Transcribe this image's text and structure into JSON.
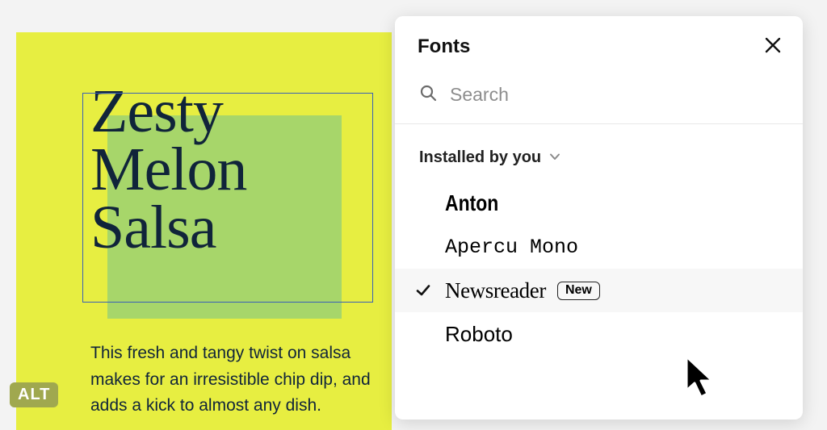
{
  "canvas": {
    "headline": "Zesty\nMelon\nSalsa",
    "body": "This fresh and tangy twist on salsa makes for an irresistible chip dip, and adds a kick to almost any dish."
  },
  "alt_badge": "ALT",
  "panel": {
    "title": "Fonts",
    "search_placeholder": "Search",
    "section_label": "Installed by you",
    "new_badge_label": "New",
    "fonts": {
      "anton": "Anton",
      "apercu": "Apercu Mono",
      "newsreader": "Newsreader",
      "roboto": "Roboto"
    }
  }
}
